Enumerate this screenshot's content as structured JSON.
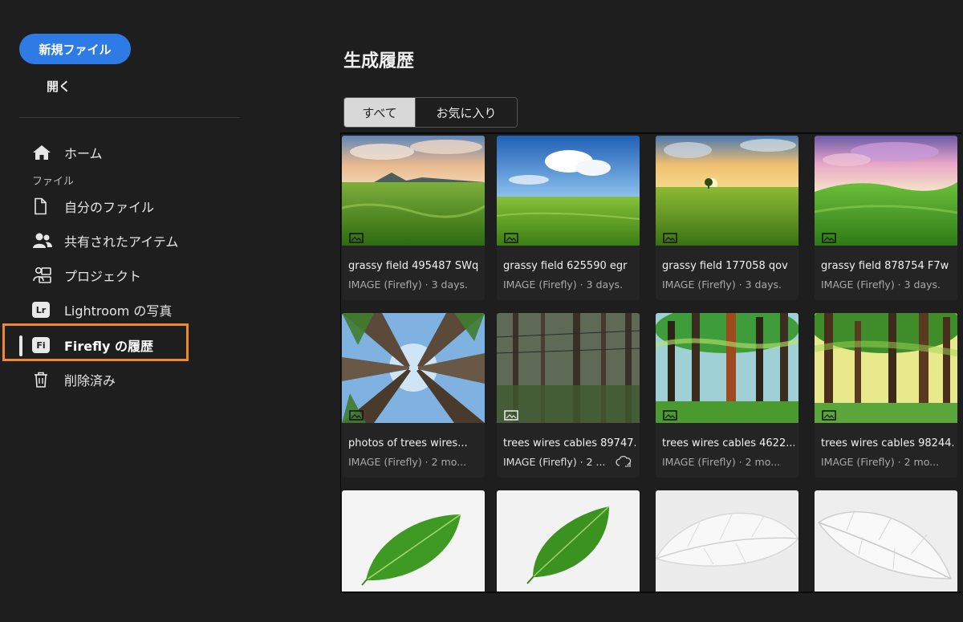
{
  "sidebar": {
    "new_file_label": "新規ファイル",
    "open_label": "開く",
    "home_label": "ホーム",
    "files_section_label": "ファイル",
    "items": [
      {
        "label": "自分のファイル",
        "icon": "document-icon"
      },
      {
        "label": "共有されたアイテム",
        "icon": "people-icon"
      },
      {
        "label": "プロジェクト",
        "icon": "project-icon"
      },
      {
        "label": "Lightroom の写真",
        "icon": "lightroom-icon",
        "badge": "Lr"
      },
      {
        "label": "Firefly の履歴",
        "icon": "firefly-icon",
        "badge": "Fi",
        "active": true
      },
      {
        "label": "削除済み",
        "icon": "trash-icon"
      }
    ]
  },
  "main": {
    "title": "生成履歴",
    "tabs": [
      {
        "label": "すべて",
        "selected": true
      },
      {
        "label": "お気に入り",
        "selected": false
      }
    ],
    "cards": [
      {
        "name": "grassy field 495487 SWq",
        "meta": "IMAGE (Firefly) · 3 days..."
      },
      {
        "name": "grassy field 625590 egr",
        "meta": "IMAGE (Firefly) · 3 days..."
      },
      {
        "name": "grassy field 177058 qov",
        "meta": "IMAGE (Firefly) · 3 days..."
      },
      {
        "name": "grassy field 878754 F7w",
        "meta": "IMAGE (Firefly) · 3 days..."
      },
      {
        "name": "photos of trees wires...",
        "meta": "IMAGE (Firefly) · 2 mo..."
      },
      {
        "name": "trees wires cables 89747...",
        "meta": "IMAGE (Firefly) · 2 ...",
        "syncing": true
      },
      {
        "name": "trees wires cables 4622...",
        "meta": "IMAGE (Firefly) · 2 mo..."
      },
      {
        "name": "trees wires cables 98244...",
        "meta": "IMAGE (Firefly) · 2 mo..."
      },
      {
        "name": "",
        "meta": ""
      },
      {
        "name": "",
        "meta": ""
      },
      {
        "name": "",
        "meta": ""
      },
      {
        "name": "",
        "meta": ""
      }
    ]
  },
  "colors": {
    "accent": "#2f7be6",
    "highlight": "#f08a24",
    "background": "#1e1e1e"
  }
}
